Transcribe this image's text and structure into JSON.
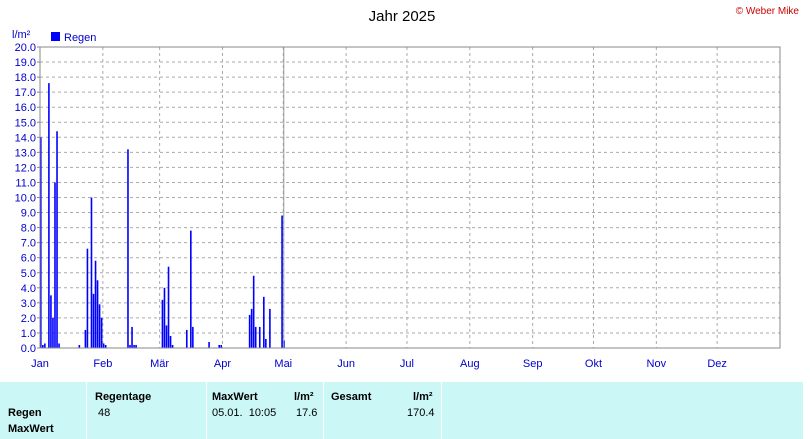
{
  "copyright": "© Weber Mike",
  "chart_data": {
    "type": "bar",
    "title": "Jahr 2025",
    "ylabel": "l/m²",
    "ylim": [
      0,
      20
    ],
    "yticks": [
      "0.0",
      "1.0",
      "2.0",
      "3.0",
      "4.0",
      "5.0",
      "6.0",
      "7.0",
      "8.0",
      "9.0",
      "10.0",
      "11.0",
      "12.0",
      "13.0",
      "14.0",
      "15.0",
      "16.0",
      "17.0",
      "18.0",
      "19.0",
      "20.0"
    ],
    "months": [
      "Jan",
      "Feb",
      "Mär",
      "Apr",
      "Mai",
      "Jun",
      "Jul",
      "Aug",
      "Sep",
      "Okt",
      "Nov",
      "Dez"
    ],
    "grid": true,
    "legend_position": "top-left",
    "series": [
      {
        "name": "Regen",
        "color": "#0000ff",
        "points": [
          {
            "day": 1,
            "value": 14.0
          },
          {
            "day": 2,
            "value": 0.2
          },
          {
            "day": 3,
            "value": 0.3
          },
          {
            "day": 5,
            "value": 17.6
          },
          {
            "day": 6,
            "value": 3.5
          },
          {
            "day": 7,
            "value": 2.0
          },
          {
            "day": 8,
            "value": 11.0
          },
          {
            "day": 9,
            "value": 14.4
          },
          {
            "day": 10,
            "value": 0.3
          },
          {
            "day": 20,
            "value": 0.2
          },
          {
            "day": 23,
            "value": 1.2
          },
          {
            "day": 24,
            "value": 6.6
          },
          {
            "day": 26,
            "value": 10.0
          },
          {
            "day": 27,
            "value": 3.6
          },
          {
            "day": 28,
            "value": 5.8
          },
          {
            "day": 29,
            "value": 4.5
          },
          {
            "day": 30,
            "value": 2.9
          },
          {
            "day": 31,
            "value": 2.0
          },
          {
            "day": 32,
            "value": 0.3
          },
          {
            "day": 33,
            "value": 0.2
          },
          {
            "day": 44,
            "value": 13.2
          },
          {
            "day": 45,
            "value": 0.2
          },
          {
            "day": 46,
            "value": 1.4
          },
          {
            "day": 47,
            "value": 0.2
          },
          {
            "day": 48,
            "value": 0.2
          },
          {
            "day": 61,
            "value": 3.2
          },
          {
            "day": 62,
            "value": 4.0
          },
          {
            "day": 63,
            "value": 1.5
          },
          {
            "day": 64,
            "value": 5.4
          },
          {
            "day": 65,
            "value": 0.8
          },
          {
            "day": 66,
            "value": 0.2
          },
          {
            "day": 73,
            "value": 1.2
          },
          {
            "day": 75,
            "value": 7.8
          },
          {
            "day": 76,
            "value": 1.4
          },
          {
            "day": 84,
            "value": 0.4
          },
          {
            "day": 89,
            "value": 0.2
          },
          {
            "day": 90,
            "value": 0.2
          },
          {
            "day": 104,
            "value": 2.2
          },
          {
            "day": 105,
            "value": 2.6
          },
          {
            "day": 106,
            "value": 4.8
          },
          {
            "day": 107,
            "value": 1.4
          },
          {
            "day": 109,
            "value": 1.4
          },
          {
            "day": 111,
            "value": 3.4
          },
          {
            "day": 112,
            "value": 0.6
          },
          {
            "day": 114,
            "value": 2.6
          },
          {
            "day": 120,
            "value": 8.8
          },
          {
            "day": 121,
            "value": 0.5
          }
        ]
      }
    ]
  },
  "stats": {
    "row_labels": [
      "Regen",
      "MaxWert"
    ],
    "regentage_header": "Regentage",
    "regentage_value": "48",
    "maxwert_header": "MaxWert",
    "maxwert_unit": "l/m²",
    "maxwert_date": "05.01.  10:05",
    "maxwert_value": "17.6",
    "gesamt_header": "Gesamt",
    "gesamt_unit": "l/m²",
    "gesamt_value": "170.4"
  }
}
